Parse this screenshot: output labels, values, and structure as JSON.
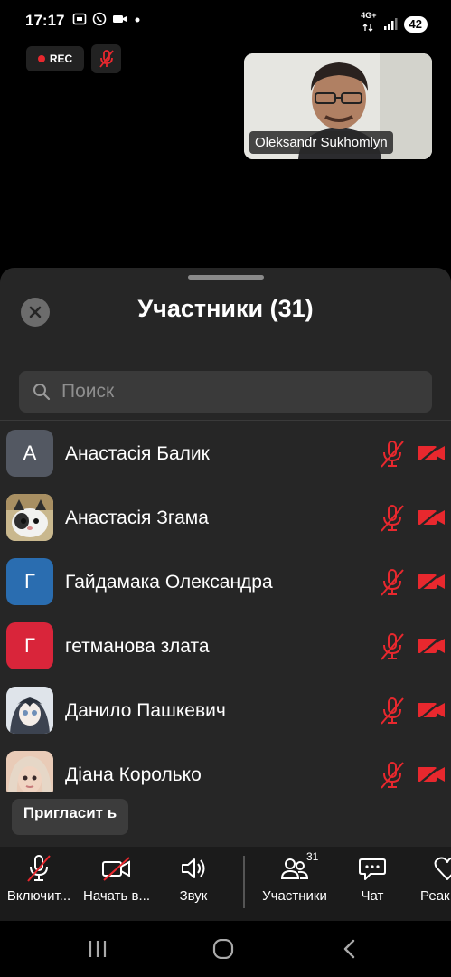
{
  "status_bar": {
    "time": "17:17",
    "network_top": "4G+",
    "battery": "42"
  },
  "recording": {
    "label": "REC"
  },
  "video_tile": {
    "name": "Oleksandr Sukhomlyn"
  },
  "sheet": {
    "title": "Участники (31)",
    "search_placeholder": "Поиск"
  },
  "participants": [
    {
      "initial": "A",
      "name": "Анастасія Балик",
      "avatar_color": "#535862"
    },
    {
      "initial": "",
      "name": "Анастасія Згама",
      "avatar_color": "#b9a57c"
    },
    {
      "initial": "Г",
      "name": "Гайдамака Олександра",
      "avatar_color": "#2a6db0"
    },
    {
      "initial": "Г",
      "name": "гетманова злата",
      "avatar_color": "#d9253a"
    },
    {
      "initial": "",
      "name": "Данило Пашкевич",
      "avatar_color": "#8d98a8"
    },
    {
      "initial": "",
      "name": "Діана Королько",
      "avatar_color": "#d8b7a1"
    }
  ],
  "invite_button": {
    "label": "Пригласит ь"
  },
  "toolbar": {
    "unmute": "Включит...",
    "start_video": "Начать в...",
    "audio": "Звук",
    "participants": "Участники",
    "participants_count": "31",
    "chat": "Чат",
    "reactions": "Реак"
  },
  "colors": {
    "accent_red": "#e8282e",
    "sheet_bg": "#262626",
    "toolbar_bg": "#1b1b1b"
  }
}
